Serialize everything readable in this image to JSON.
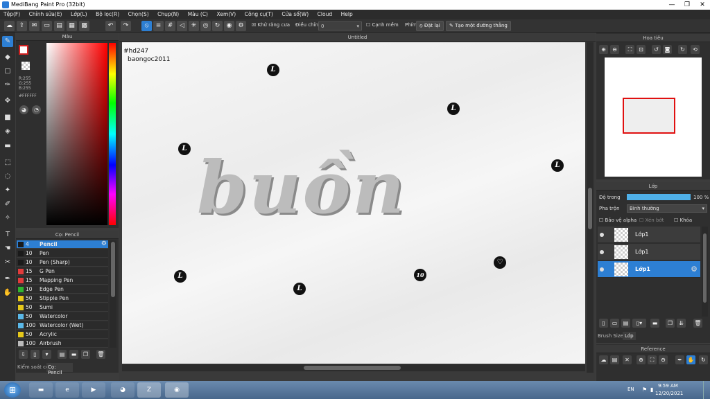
{
  "window": {
    "title": "MediBang Paint Pro (32bit)"
  },
  "menu": [
    "Tệp(F)",
    "Chỉnh sửa(E)",
    "Lớp(L)",
    "Bộ lọc(R)",
    "Chọn(S)",
    "Chụp(N)",
    "Màu (C)",
    "Xem(V)",
    "Công cụ(T)",
    "Cửa sổ(W)",
    "Cloud",
    "Help"
  ],
  "toolbar": {
    "antialias_label": "Khử răng cưa",
    "adjust_label": "Điều chỉnh",
    "adjust_value": "0",
    "soft_edge_label": "Cạnh mềm",
    "phim_label": "Phím",
    "reset_label": "Đặt lại",
    "straight_line_label": "Tạo một đường thẳng"
  },
  "color_panel": {
    "title": "Màu",
    "rgb_r": "R:255",
    "rgb_g": "G:255",
    "rgb_b": "B:255",
    "hex": "#FFFFFF",
    "primary": "#ffffff",
    "secondary": "#d32020"
  },
  "brush_panel": {
    "title": "Cọ: Pencil",
    "items": [
      {
        "size": "4",
        "name": "Pencil",
        "color": "#1a1a1a"
      },
      {
        "size": "10",
        "name": "Pen",
        "color": "#1a1a1a"
      },
      {
        "size": "10",
        "name": "Pen (Sharp)",
        "color": "#1a1a1a"
      },
      {
        "size": "15",
        "name": "G Pen",
        "color": "#e23b3b"
      },
      {
        "size": "15",
        "name": "Mapping Pen",
        "color": "#e23b3b"
      },
      {
        "size": "10",
        "name": "Edge Pen",
        "color": "#2fb52f"
      },
      {
        "size": "50",
        "name": "Stipple Pen",
        "color": "#e6c81a"
      },
      {
        "size": "50",
        "name": "Sumi",
        "color": "#e6c81a"
      },
      {
        "size": "50",
        "name": "Watercolor",
        "color": "#5ab8e8"
      },
      {
        "size": "100",
        "name": "Watercolor (Wet)",
        "color": "#5ab8e8"
      },
      {
        "size": "50",
        "name": "Acrylic",
        "color": "#e6c81a"
      },
      {
        "size": "100",
        "name": "Airbrush",
        "color": "#bbbbbb"
      }
    ],
    "tabs": [
      "Kiểm soát cọ",
      "Cọ: Pencil"
    ]
  },
  "canvas": {
    "tab_title": "Untitled",
    "text_tag": "#hd247",
    "text_user": "baongoc2011",
    "art_word": "buồn",
    "bubbles": [
      "L",
      "L",
      "L",
      "L",
      "L",
      "L",
      "10",
      "♡"
    ]
  },
  "navigator": {
    "title": "Hoa tiêu"
  },
  "layer_panel": {
    "title": "Lớp",
    "opacity_label": "Độ trong",
    "opacity_value": "100 %",
    "opacity_fraction": 1.0,
    "blend_label": "Pha trộn",
    "blend_value": "Bình thường",
    "protect_alpha": "Bảo vệ alpha",
    "clipping": "Xén bớt",
    "lock": "Khóa",
    "layers": [
      {
        "name": "Lớp1"
      },
      {
        "name": "Lớp1"
      },
      {
        "name": "Lớp1"
      }
    ],
    "bottom_tabs": [
      "Brush Size",
      "Lớp"
    ]
  },
  "reference_panel": {
    "title": "Reference"
  },
  "taskbar": {
    "apps": [
      "Windows",
      "File Explorer",
      "Internet Explorer",
      "Media",
      "Cốc Cốc",
      "Zalo",
      "Chrome"
    ],
    "lang": "EN",
    "time": "9:59 AM",
    "date": "12/20/2021"
  }
}
